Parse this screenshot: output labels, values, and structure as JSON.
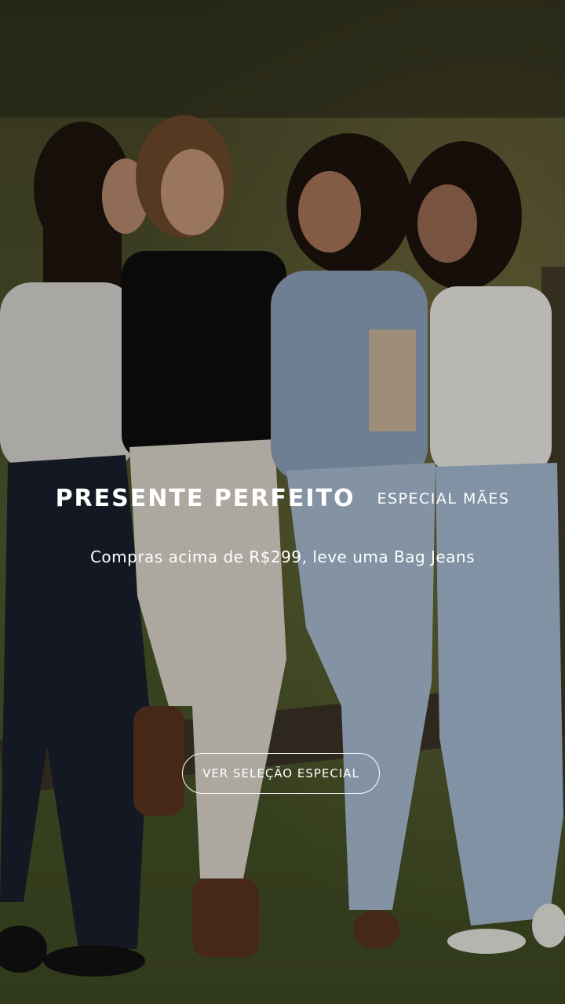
{
  "banner": {
    "title": "PRESENTE PERFEITO",
    "tag": "ESPECIAL MÃES",
    "subtitle": "Compras acima de R$299, leve uma Bag Jeans",
    "cta_label": "VER SELEÇÃO ESPECIAL"
  },
  "colors": {
    "text": "#ffffff",
    "overlay": "#000000",
    "grass": "#5a6a2e",
    "denim_light": "#9fb3c8",
    "denim_dark": "#1c2336"
  }
}
